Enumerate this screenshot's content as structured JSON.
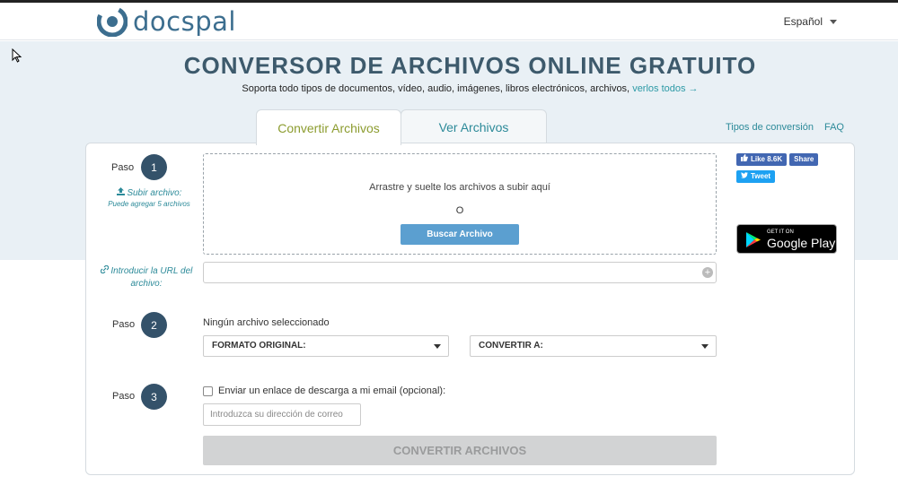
{
  "header": {
    "logo_text": "docspal",
    "language": "Español"
  },
  "hero": {
    "title": "CONVERSOR DE ARCHIVOS ONLINE GRATUITO",
    "subtitle": "Soporta todo tipos de documentos, vídeo, audio, imágenes, libros electrónicos, archivos,",
    "subtitle_link": "verlos todos →"
  },
  "tabs": [
    {
      "label": "Convertir Archivos",
      "active": true
    },
    {
      "label": "Ver Archivos",
      "active": false
    }
  ],
  "top_links": {
    "conversion_types": "Tipos de conversión",
    "faq": "FAQ"
  },
  "step1": {
    "label": "Paso",
    "number": "1",
    "upload_link": "Subir archivo:",
    "upload_note": "Puede agregar 5 archivos",
    "drop_text": "Arrastre y suelte los archivos a subir aquí",
    "or_text": "O",
    "browse_button": "Buscar Archivo",
    "url_link": "Introducir la URL del archivo:"
  },
  "step2": {
    "label": "Paso",
    "number": "2",
    "no_file": "Ningún archivo seleccionado",
    "source_format": "FORMATO ORIGINAL:",
    "target_format": "CONVERTIR A:"
  },
  "step3": {
    "label": "Paso",
    "number": "3",
    "email_checkbox": "Enviar un enlace de descarga a mi email (opcional):",
    "email_placeholder": "Introduzca su dirección de correo"
  },
  "convert_button": "CONVERTIR ARCHIVOS",
  "social": {
    "like": "Like 8.6K",
    "share": "Share",
    "tweet": "Tweet",
    "gplay_small": "GET IT ON",
    "gplay_big": "Google Play"
  },
  "colors": {
    "hero_bg": "#e9f0f5",
    "title": "#3d5a6c",
    "accent": "#2c8a99",
    "active_tab": "#8c9c2f",
    "step_circle": "#34526a",
    "browse_button": "#5b9fd0"
  }
}
